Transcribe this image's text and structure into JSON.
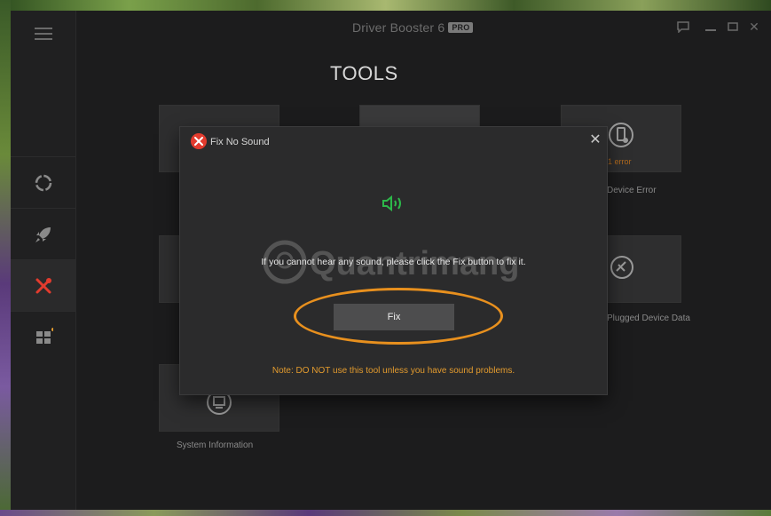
{
  "window": {
    "title": "Driver Booster 6",
    "badge": "PRO"
  },
  "page": {
    "title": "TOOLS"
  },
  "tools": [
    {
      "label": "",
      "error_text": ""
    },
    {
      "label": "",
      "error_text": ""
    },
    {
      "label": "Device Error",
      "error_text": "1 error"
    },
    {
      "label": "",
      "error_text": ""
    },
    {
      "label": "Plugged Device Data",
      "error_text": ""
    },
    {
      "label": "System Information",
      "error_text": ""
    }
  ],
  "dialog": {
    "title": "Fix No Sound",
    "close_glyph": "✕",
    "message": "If you cannot hear any sound, please click the Fix button to fix it.",
    "fix_label": "Fix",
    "note": "Note: DO NOT use this tool unless you have sound problems.",
    "watermark": "Quantrimang"
  },
  "window_controls": {
    "close_glyph": "✕",
    "minimize_glyph": "—"
  },
  "colors": {
    "accent_orange": "#e39b2e",
    "speaker_green": "#2db84a",
    "active_red": "#e23b2e"
  },
  "icons": {
    "menu": "hamburger-icon",
    "scan": "scan-icon",
    "boost": "rocket-icon",
    "tools": "tools-icon",
    "apps": "apps-grid-icon",
    "speaker": "speaker-icon",
    "feedback": "chat-icon"
  }
}
